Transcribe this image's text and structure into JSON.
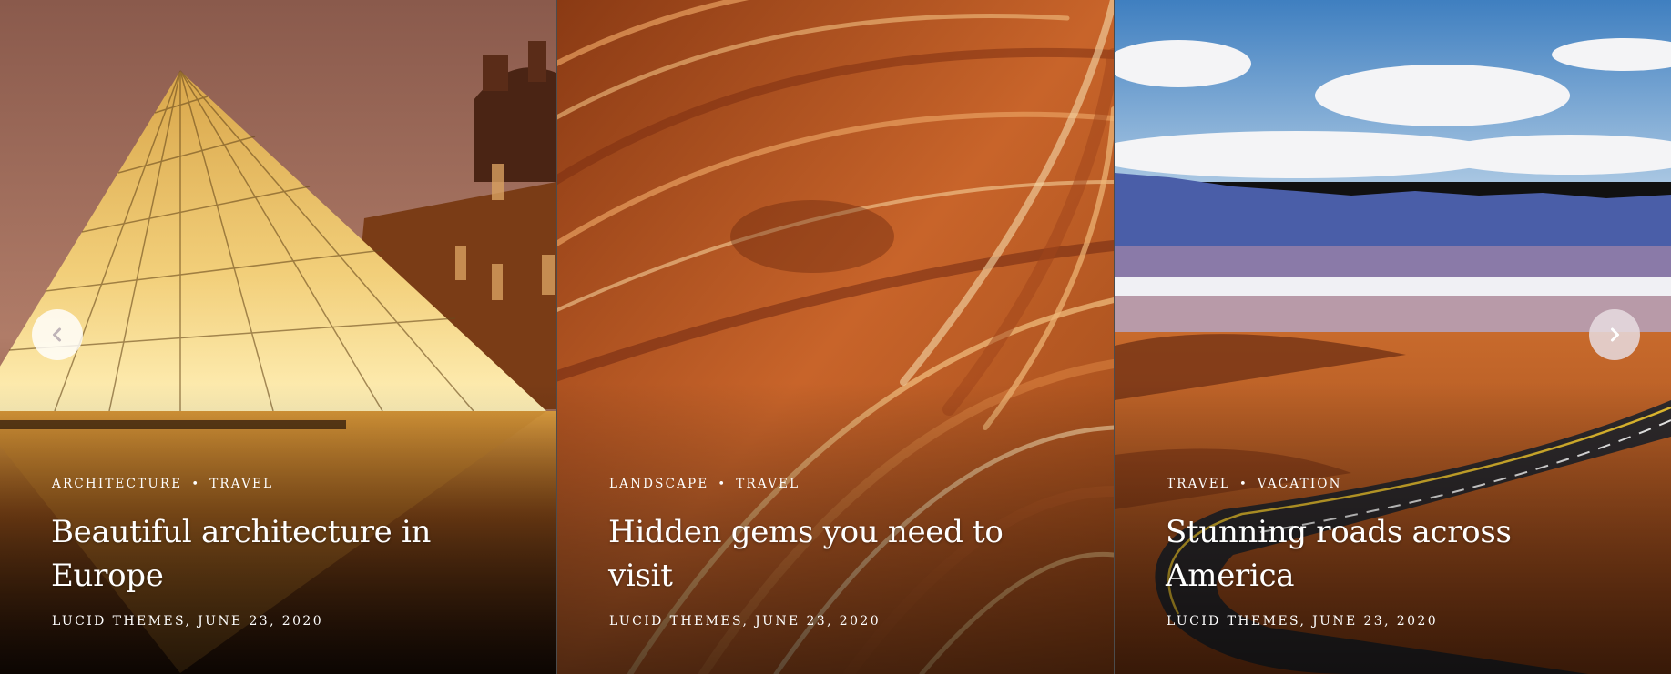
{
  "slides": [
    {
      "categories": [
        "Architecture",
        "Travel"
      ],
      "separator": "•",
      "title_line1": "Beautiful architecture in",
      "title_line2": "Europe",
      "meta": "Lucid Themes, June 23, 2020"
    },
    {
      "categories": [
        "Landscape",
        "Travel"
      ],
      "separator": "•",
      "title_line1": "Hidden gems you need to",
      "title_line2": "visit",
      "meta": "Lucid Themes, June 23, 2020"
    },
    {
      "categories": [
        "Travel",
        "Vacation"
      ],
      "separator": "•",
      "title_line1": "Stunning roads across",
      "title_line2": "America",
      "meta": "Lucid Themes, June 23, 2020"
    }
  ],
  "nav": {
    "prev_icon": "chevron-left-icon",
    "next_icon": "chevron-right-icon"
  },
  "colors": {
    "text": "#ffffff",
    "nav_bg": "#f5f2f3",
    "nav_icon": "#bfb4b8"
  }
}
